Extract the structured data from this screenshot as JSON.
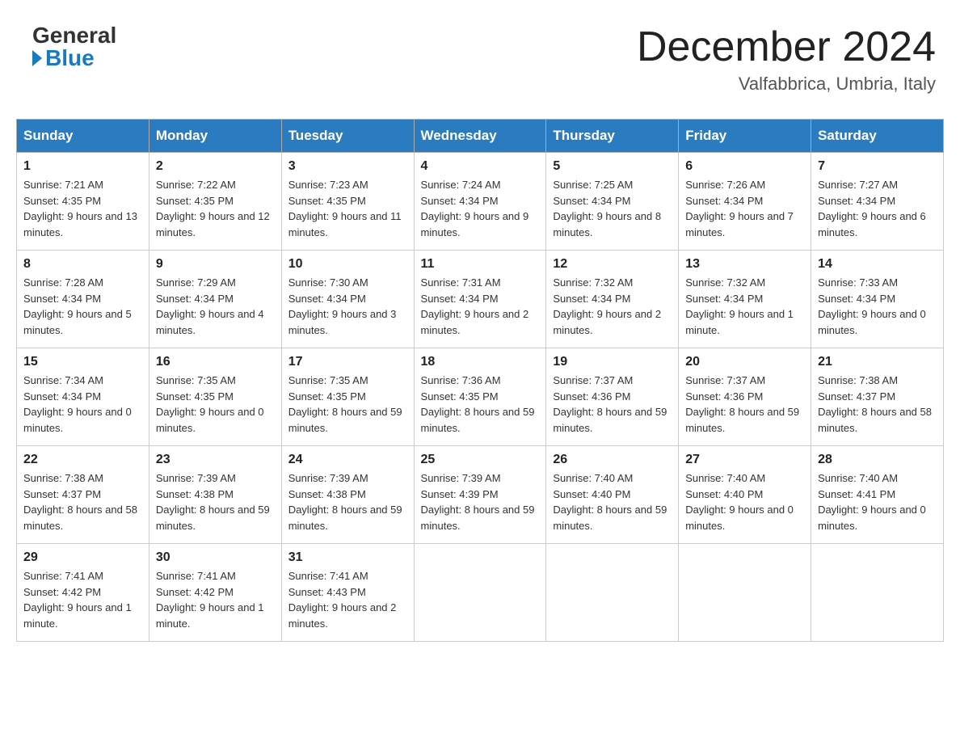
{
  "header": {
    "logo_general": "General",
    "logo_blue": "Blue",
    "month_title": "December 2024",
    "location": "Valfabbrica, Umbria, Italy"
  },
  "weekdays": [
    "Sunday",
    "Monday",
    "Tuesday",
    "Wednesday",
    "Thursday",
    "Friday",
    "Saturday"
  ],
  "weeks": [
    [
      {
        "day": "1",
        "sunrise": "7:21 AM",
        "sunset": "4:35 PM",
        "daylight": "9 hours and 13 minutes."
      },
      {
        "day": "2",
        "sunrise": "7:22 AM",
        "sunset": "4:35 PM",
        "daylight": "9 hours and 12 minutes."
      },
      {
        "day": "3",
        "sunrise": "7:23 AM",
        "sunset": "4:35 PM",
        "daylight": "9 hours and 11 minutes."
      },
      {
        "day": "4",
        "sunrise": "7:24 AM",
        "sunset": "4:34 PM",
        "daylight": "9 hours and 9 minutes."
      },
      {
        "day": "5",
        "sunrise": "7:25 AM",
        "sunset": "4:34 PM",
        "daylight": "9 hours and 8 minutes."
      },
      {
        "day": "6",
        "sunrise": "7:26 AM",
        "sunset": "4:34 PM",
        "daylight": "9 hours and 7 minutes."
      },
      {
        "day": "7",
        "sunrise": "7:27 AM",
        "sunset": "4:34 PM",
        "daylight": "9 hours and 6 minutes."
      }
    ],
    [
      {
        "day": "8",
        "sunrise": "7:28 AM",
        "sunset": "4:34 PM",
        "daylight": "9 hours and 5 minutes."
      },
      {
        "day": "9",
        "sunrise": "7:29 AM",
        "sunset": "4:34 PM",
        "daylight": "9 hours and 4 minutes."
      },
      {
        "day": "10",
        "sunrise": "7:30 AM",
        "sunset": "4:34 PM",
        "daylight": "9 hours and 3 minutes."
      },
      {
        "day": "11",
        "sunrise": "7:31 AM",
        "sunset": "4:34 PM",
        "daylight": "9 hours and 2 minutes."
      },
      {
        "day": "12",
        "sunrise": "7:32 AM",
        "sunset": "4:34 PM",
        "daylight": "9 hours and 2 minutes."
      },
      {
        "day": "13",
        "sunrise": "7:32 AM",
        "sunset": "4:34 PM",
        "daylight": "9 hours and 1 minute."
      },
      {
        "day": "14",
        "sunrise": "7:33 AM",
        "sunset": "4:34 PM",
        "daylight": "9 hours and 0 minutes."
      }
    ],
    [
      {
        "day": "15",
        "sunrise": "7:34 AM",
        "sunset": "4:34 PM",
        "daylight": "9 hours and 0 minutes."
      },
      {
        "day": "16",
        "sunrise": "7:35 AM",
        "sunset": "4:35 PM",
        "daylight": "9 hours and 0 minutes."
      },
      {
        "day": "17",
        "sunrise": "7:35 AM",
        "sunset": "4:35 PM",
        "daylight": "8 hours and 59 minutes."
      },
      {
        "day": "18",
        "sunrise": "7:36 AM",
        "sunset": "4:35 PM",
        "daylight": "8 hours and 59 minutes."
      },
      {
        "day": "19",
        "sunrise": "7:37 AM",
        "sunset": "4:36 PM",
        "daylight": "8 hours and 59 minutes."
      },
      {
        "day": "20",
        "sunrise": "7:37 AM",
        "sunset": "4:36 PM",
        "daylight": "8 hours and 59 minutes."
      },
      {
        "day": "21",
        "sunrise": "7:38 AM",
        "sunset": "4:37 PM",
        "daylight": "8 hours and 58 minutes."
      }
    ],
    [
      {
        "day": "22",
        "sunrise": "7:38 AM",
        "sunset": "4:37 PM",
        "daylight": "8 hours and 58 minutes."
      },
      {
        "day": "23",
        "sunrise": "7:39 AM",
        "sunset": "4:38 PM",
        "daylight": "8 hours and 59 minutes."
      },
      {
        "day": "24",
        "sunrise": "7:39 AM",
        "sunset": "4:38 PM",
        "daylight": "8 hours and 59 minutes."
      },
      {
        "day": "25",
        "sunrise": "7:39 AM",
        "sunset": "4:39 PM",
        "daylight": "8 hours and 59 minutes."
      },
      {
        "day": "26",
        "sunrise": "7:40 AM",
        "sunset": "4:40 PM",
        "daylight": "8 hours and 59 minutes."
      },
      {
        "day": "27",
        "sunrise": "7:40 AM",
        "sunset": "4:40 PM",
        "daylight": "9 hours and 0 minutes."
      },
      {
        "day": "28",
        "sunrise": "7:40 AM",
        "sunset": "4:41 PM",
        "daylight": "9 hours and 0 minutes."
      }
    ],
    [
      {
        "day": "29",
        "sunrise": "7:41 AM",
        "sunset": "4:42 PM",
        "daylight": "9 hours and 1 minute."
      },
      {
        "day": "30",
        "sunrise": "7:41 AM",
        "sunset": "4:42 PM",
        "daylight": "9 hours and 1 minute."
      },
      {
        "day": "31",
        "sunrise": "7:41 AM",
        "sunset": "4:43 PM",
        "daylight": "9 hours and 2 minutes."
      },
      null,
      null,
      null,
      null
    ]
  ],
  "labels": {
    "sunrise": "Sunrise:",
    "sunset": "Sunset:",
    "daylight": "Daylight:"
  }
}
